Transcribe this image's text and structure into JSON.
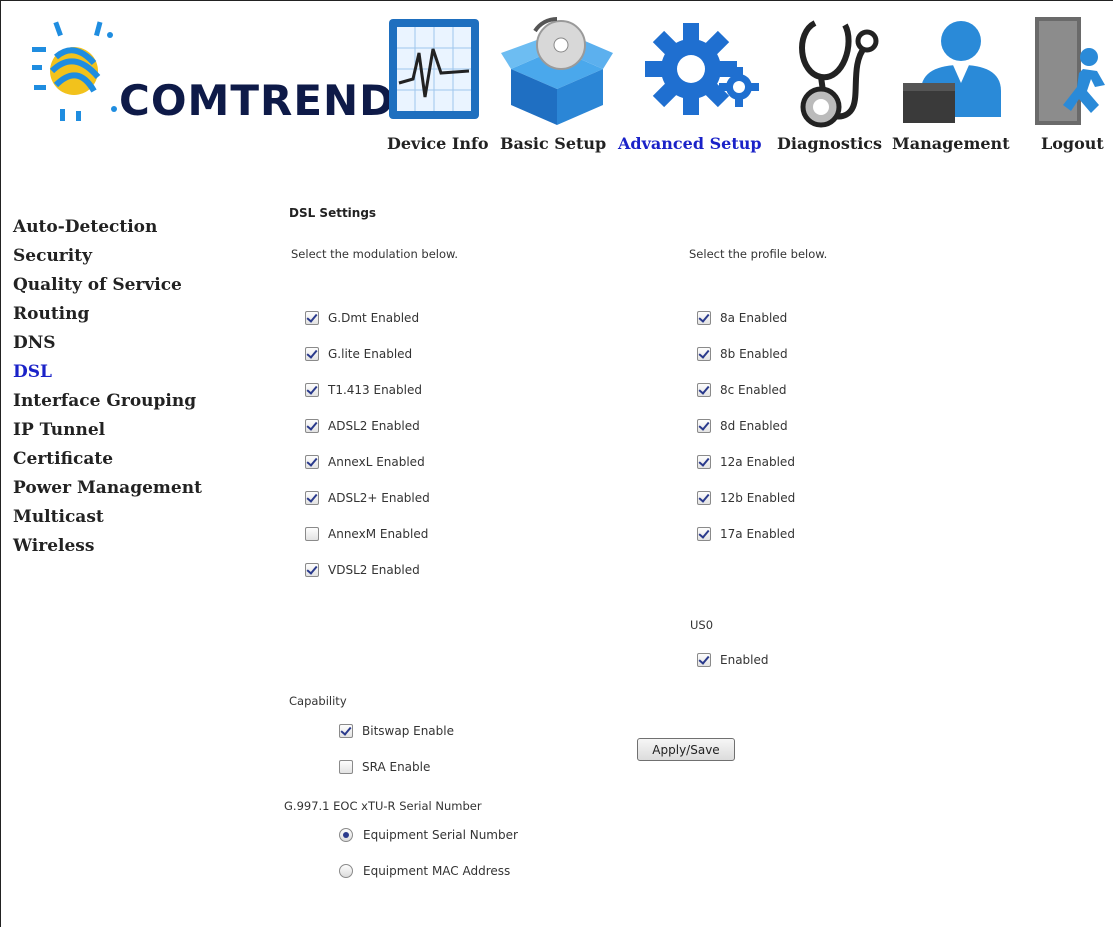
{
  "brand": {
    "name": "COMTREND"
  },
  "nav": [
    {
      "label": "Device Info",
      "icon": "device-info-icon"
    },
    {
      "label": "Basic Setup",
      "icon": "basic-setup-icon"
    },
    {
      "label": "Advanced Setup",
      "icon": "advanced-setup-icon",
      "active": true
    },
    {
      "label": "Diagnostics",
      "icon": "diagnostics-icon"
    },
    {
      "label": "Management",
      "icon": "management-icon"
    },
    {
      "label": "Logout",
      "icon": "logout-icon"
    }
  ],
  "sidebar": {
    "items": [
      {
        "label": "Auto-Detection"
      },
      {
        "label": "Security"
      },
      {
        "label": "Quality of Service"
      },
      {
        "label": "Routing"
      },
      {
        "label": "DNS"
      },
      {
        "label": "DSL",
        "active": true
      },
      {
        "label": "Interface Grouping"
      },
      {
        "label": "IP Tunnel"
      },
      {
        "label": "Certificate"
      },
      {
        "label": "Power Management"
      },
      {
        "label": "Multicast"
      },
      {
        "label": "Wireless"
      }
    ]
  },
  "dsl": {
    "title": "DSL Settings",
    "modulation_hint": "Select the modulation below.",
    "profile_hint": "Select the profile below.",
    "modulations": [
      {
        "label": "G.Dmt Enabled",
        "checked": true
      },
      {
        "label": "G.lite Enabled",
        "checked": true
      },
      {
        "label": "T1.413 Enabled",
        "checked": true
      },
      {
        "label": "ADSL2 Enabled",
        "checked": true
      },
      {
        "label": "AnnexL Enabled",
        "checked": true
      },
      {
        "label": "ADSL2+ Enabled",
        "checked": true
      },
      {
        "label": "AnnexM Enabled",
        "checked": false
      },
      {
        "label": "VDSL2 Enabled",
        "checked": true
      }
    ],
    "profiles": [
      {
        "label": "8a Enabled",
        "checked": true
      },
      {
        "label": "8b Enabled",
        "checked": true
      },
      {
        "label": "8c Enabled",
        "checked": true
      },
      {
        "label": "8d Enabled",
        "checked": true
      },
      {
        "label": "12a Enabled",
        "checked": true
      },
      {
        "label": "12b Enabled",
        "checked": true
      },
      {
        "label": "17a Enabled",
        "checked": true
      }
    ],
    "us0": {
      "title": "US0",
      "label": "Enabled",
      "checked": true
    },
    "capability": {
      "title": "Capability",
      "options": [
        {
          "label": "Bitswap Enable",
          "checked": true
        },
        {
          "label": "SRA Enable",
          "checked": false
        }
      ]
    },
    "serial": {
      "title": "G.997.1 EOC xTU-R Serial Number",
      "options": [
        {
          "label": "Equipment Serial Number",
          "selected": true
        },
        {
          "label": "Equipment MAC Address",
          "selected": false
        }
      ]
    },
    "apply_label": "Apply/Save"
  },
  "colors": {
    "active_link": "#1a22c8",
    "brand_navy": "#0e1a48",
    "logo_blue": "#1f8de0",
    "logo_yellow": "#f2c21c"
  }
}
